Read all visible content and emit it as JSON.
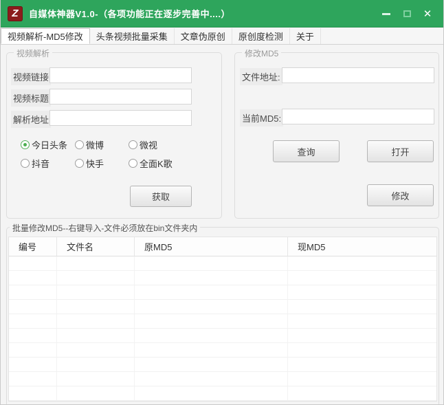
{
  "window": {
    "title": "自媒体神器V1.0-（各项功能正在逐步完善中....）",
    "controls": {
      "minimize": "最小化",
      "maximize": "最大化",
      "close": "✕"
    }
  },
  "colors": {
    "titlebar_green": "#2ea55c",
    "icon_background": "#8b1c1c",
    "radio_checked_green": "#4caf50"
  },
  "icons": {
    "app_logo_glyph": "Z"
  },
  "tabs": [
    {
      "label": "视频解析-MD5修改",
      "selected": true
    },
    {
      "label": "头条视频批量采集",
      "selected": false
    },
    {
      "label": "文章伪原创",
      "selected": false
    },
    {
      "label": "原创度检测",
      "selected": false
    },
    {
      "label": "关于",
      "selected": false
    }
  ],
  "video_parse": {
    "group_title": "视频解析",
    "fields": [
      {
        "label": "视频链接",
        "value": ""
      },
      {
        "label": "视频标题",
        "value": ""
      },
      {
        "label": "解析地址",
        "value": ""
      }
    ],
    "radios": [
      {
        "label": "今日头条",
        "selected": true
      },
      {
        "label": "微博",
        "selected": false
      },
      {
        "label": "微视",
        "selected": false
      },
      {
        "label": "抖音",
        "selected": false
      },
      {
        "label": "快手",
        "selected": false
      },
      {
        "label": "全面K歌",
        "selected": false
      }
    ],
    "get_button": "获取"
  },
  "modify_md5": {
    "group_title": "修改MD5",
    "file_label": "文件地址:",
    "file_value": "",
    "current_md5_label": "当前MD5:",
    "current_md5_value": "",
    "query_button": "查询",
    "open_button": "打开",
    "modify_button": "修改"
  },
  "batch": {
    "group_title": "批量修改MD5--右键导入-文件必须放在bin文件夹内",
    "columns": [
      "编号",
      "文件名",
      "原MD5",
      "现MD5"
    ],
    "rows": [],
    "empty_row_count": 10
  }
}
